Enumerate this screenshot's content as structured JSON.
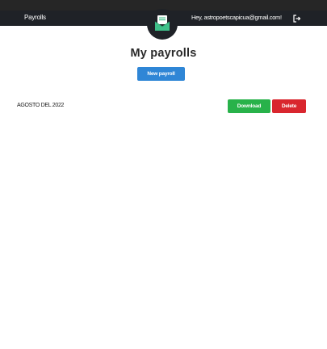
{
  "nav": {
    "brand": "Payrolls",
    "greeting": "Hey, astropoetscapicua@gmail.com!",
    "logout_icon": "logout-icon"
  },
  "logo": {
    "icon": "envelope-icon"
  },
  "main": {
    "title": "My payrolls",
    "new_button": "New payroll"
  },
  "payrolls": [
    {
      "label": "AGOSTO DEL 2022",
      "download": "Download",
      "delete": "Delete"
    }
  ],
  "colors": {
    "navbar": "#1f2227",
    "primary": "#2f86d6",
    "success": "#28b24a",
    "danger": "#d9262e",
    "logo_accent": "#3fc18a"
  }
}
